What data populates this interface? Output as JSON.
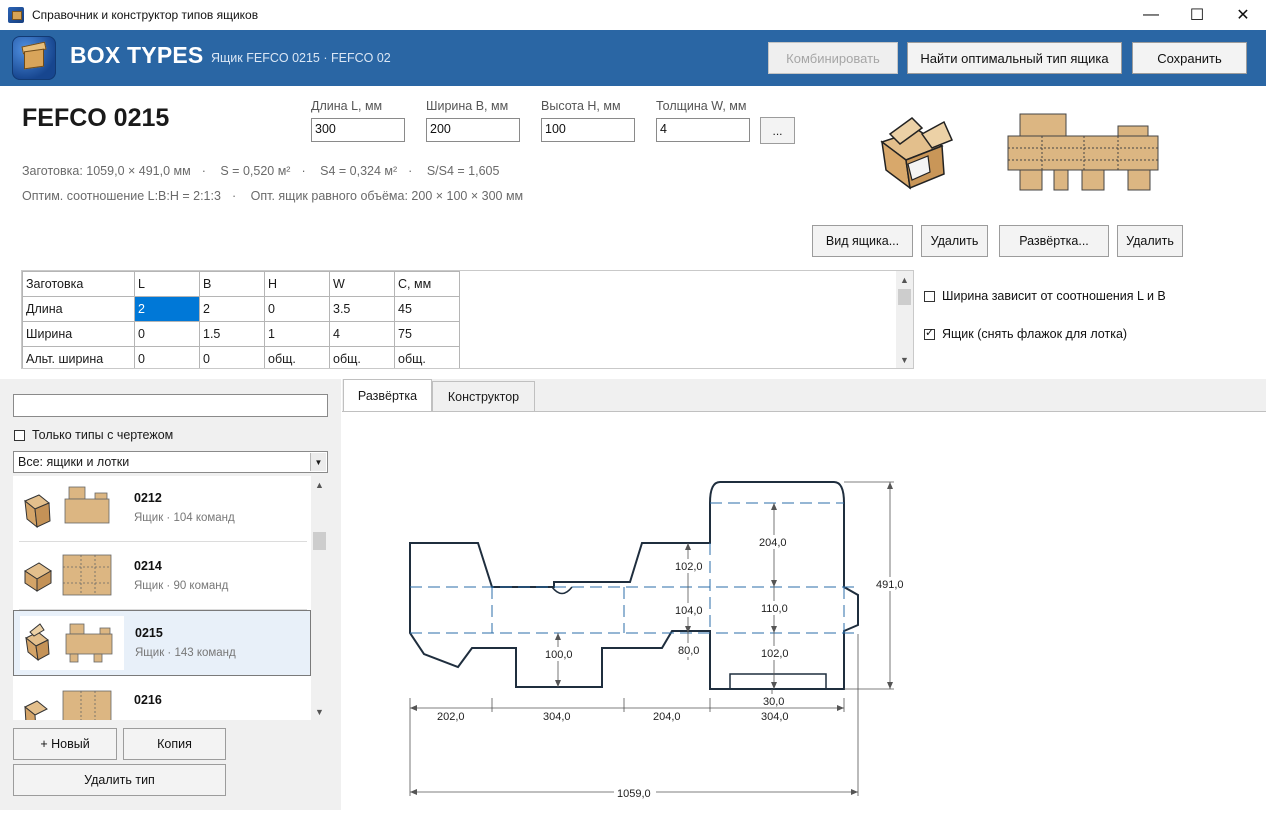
{
  "window": {
    "title": "Справочник и конструктор типов ящиков",
    "minimize": "—",
    "maximize": "☐",
    "close": "✕"
  },
  "header": {
    "brand": "BOX TYPES",
    "breadcrumb": "Ящик FEFCO 0215  ·  FEFCO 02",
    "combine_label": "Комбинировать",
    "find_optimal_label": "Найти оптимальный тип ящика",
    "save_label": "Сохранить"
  },
  "box": {
    "title": "FEFCO 0215",
    "fields": [
      {
        "label": "Длина L, мм",
        "value": "300"
      },
      {
        "label": "Ширина B, мм",
        "value": "200"
      },
      {
        "label": "Высота H, мм",
        "value": "100"
      },
      {
        "label": "Толщина W, мм",
        "value": "4"
      }
    ],
    "more_label": "...",
    "info_line1": [
      "Заготовка: 1059,0 × 491,0 мм",
      "S = 0,520 м²",
      "S4 = 0,324 м²",
      "S/S4 = 1,605"
    ],
    "info_line2": [
      "Оптим. соотношение L:B:H = 2:1:3",
      "Опт. ящик равного объёма: 200 × 100 × 300 мм"
    ],
    "view_label": "Вид ящика...",
    "delete_view_label": "Удалить",
    "unfold_label": "Развёртка...",
    "delete_unfold_label": "Удалить"
  },
  "grid": {
    "headers": [
      "Заготовка",
      "L",
      "B",
      "H",
      "W",
      "C, мм"
    ],
    "rows": [
      [
        "Длина",
        "2",
        "2",
        "0",
        "3.5",
        "45"
      ],
      [
        "Ширина",
        "0",
        "1.5",
        "1",
        "4",
        "75"
      ],
      [
        "Альт. ширина",
        "0",
        "0",
        "общ.",
        "общ.",
        "общ."
      ]
    ],
    "scroll_up": "▲",
    "scroll_down": "▼"
  },
  "options": {
    "width_depends": "Ширина зависит от соотношения L и B",
    "is_box": "Ящик (снять флажок для лотка)"
  },
  "left": {
    "search_value": "",
    "only_with_drawing": "Только типы с чертежом",
    "filter_value": "Все: ящики и лотки",
    "items": [
      {
        "name": "0212",
        "desc": "Ящик · 104 команд"
      },
      {
        "name": "0214",
        "desc": "Ящик · 90 команд"
      },
      {
        "name": "0215",
        "desc": "Ящик · 143 команд"
      },
      {
        "name": "0216",
        "desc": ""
      }
    ],
    "new_label": "+ Новый",
    "copy_label": "Копия",
    "delete_type_label": "Удалить тип"
  },
  "tabs": {
    "unfold": "Развёртка",
    "constructor": "Конструктор"
  },
  "drawing": {
    "dims": {
      "d204_top": "204,0",
      "d102_left": "102,0",
      "d104": "104,0",
      "d110": "110,0",
      "d80": "80,0",
      "d100": "100,0",
      "d102_right": "102,0",
      "d30": "30,0",
      "d491": "491,0",
      "w202": "202,0",
      "w304_a": "304,0",
      "w204": "204,0",
      "w304_b": "304,0",
      "total": "1059,0"
    }
  }
}
